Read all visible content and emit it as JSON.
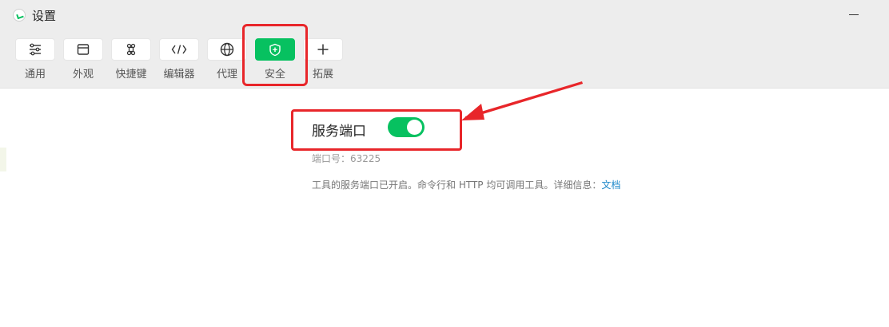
{
  "window": {
    "title": "设置"
  },
  "toolbar": {
    "tabs": [
      {
        "label": "通用",
        "icon": "sliders-icon"
      },
      {
        "label": "外观",
        "icon": "window-icon"
      },
      {
        "label": "快捷键",
        "icon": "command-key-icon"
      },
      {
        "label": "编辑器",
        "icon": "code-icon"
      },
      {
        "label": "代理",
        "icon": "globe-icon"
      },
      {
        "label": "安全",
        "icon": "shield-icon",
        "active": true
      },
      {
        "label": "拓展",
        "icon": "plus-icon"
      }
    ]
  },
  "security": {
    "service_port_label": "服务端口",
    "service_port_enabled": true,
    "port_label": "端口号：",
    "port_value": "63225",
    "description": "工具的服务端口已开启。命令行和 HTTP 均可调用工具。详细信息：",
    "doc_link": "文档"
  },
  "colors": {
    "accent": "#07c160",
    "annotation": "#e8262a",
    "link": "#1e88c9"
  }
}
